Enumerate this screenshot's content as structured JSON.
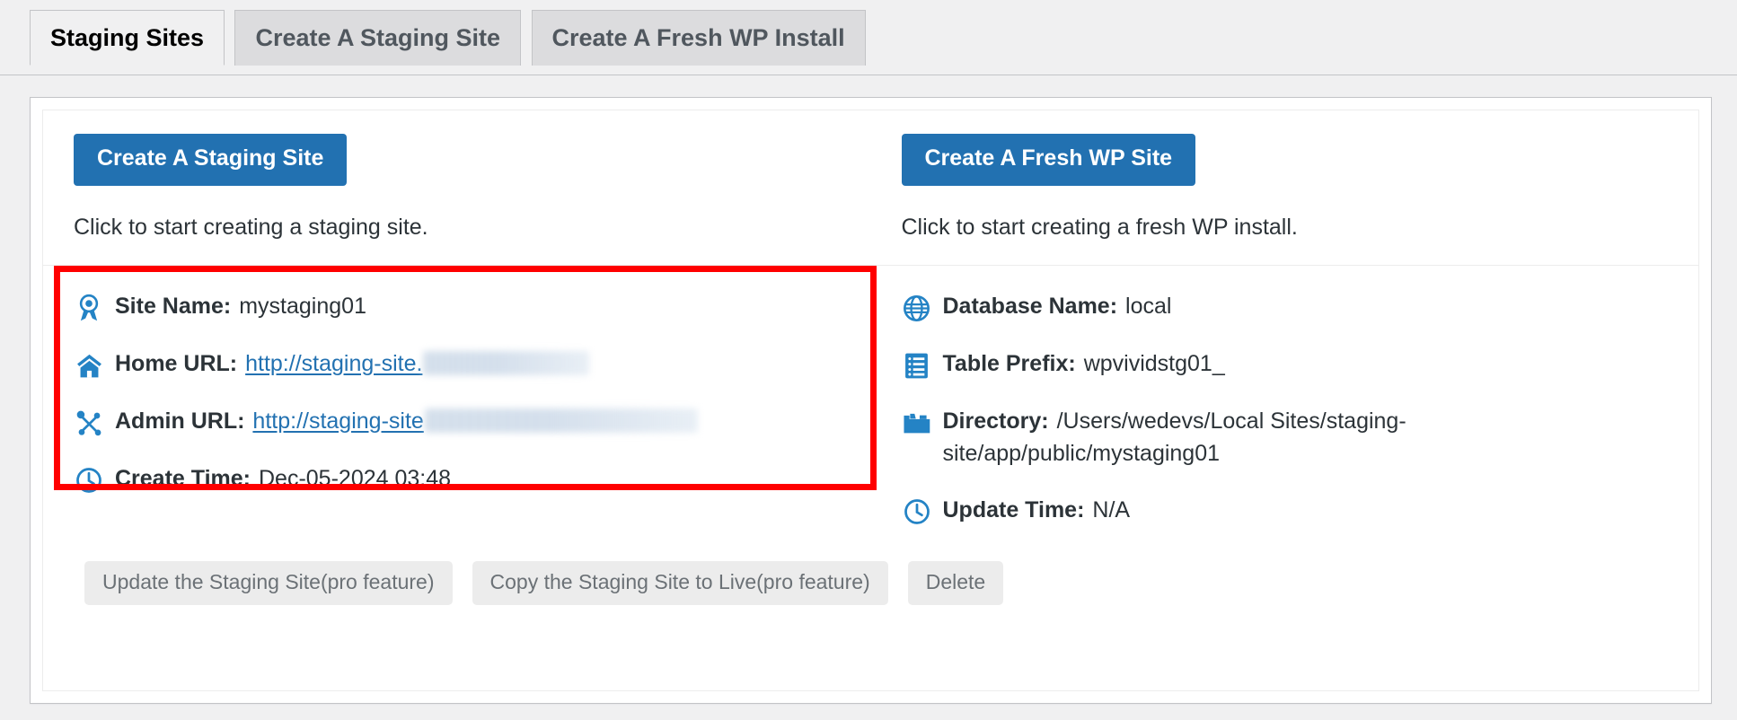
{
  "tabs": [
    {
      "label": "Staging Sites",
      "active": true
    },
    {
      "label": "Create A Staging Site",
      "active": false
    },
    {
      "label": "Create A Fresh WP Install",
      "active": false
    }
  ],
  "actions": {
    "staging": {
      "button_label": "Create A Staging Site",
      "helper_text": "Click to start creating a staging site."
    },
    "fresh": {
      "button_label": "Create A Fresh WP Site",
      "helper_text": "Click to start creating a fresh WP install."
    }
  },
  "site_info": {
    "left": [
      {
        "icon": "ribbon-badge-icon",
        "label": "Site Name:",
        "value": "mystaging01",
        "type": "text"
      },
      {
        "icon": "home-icon",
        "label": "Home URL:",
        "value": "http://staging-site.",
        "type": "link-redacted"
      },
      {
        "icon": "admin-network-icon",
        "label": "Admin URL:",
        "value": "http://staging-site",
        "type": "link-redacted"
      },
      {
        "icon": "clock-icon",
        "label": "Create Time:",
        "value": "Dec-05-2024 03:48",
        "type": "text"
      }
    ],
    "right": [
      {
        "icon": "globe-icon",
        "label": "Database Name:",
        "value": "local",
        "type": "text"
      },
      {
        "icon": "table-list-icon",
        "label": "Table Prefix:",
        "value": "wpvividstg01_",
        "type": "text"
      },
      {
        "icon": "folder-icon",
        "label": "Directory:",
        "value": "/Users/wedevs/Local Sites/staging-site/app/public/mystaging01",
        "type": "text"
      },
      {
        "icon": "clock-icon",
        "label": "Update Time:",
        "value": "N/A",
        "type": "text"
      }
    ]
  },
  "footer_buttons": [
    {
      "label": "Update the Staging Site(pro feature)"
    },
    {
      "label": "Copy the Staging Site to Live(pro feature)"
    },
    {
      "label": "Delete"
    }
  ],
  "colors": {
    "accent_blue": "#2271b1",
    "highlight_red": "#ff0000",
    "page_bg": "#f0f0f1",
    "muted_button_bg": "#ececec"
  }
}
